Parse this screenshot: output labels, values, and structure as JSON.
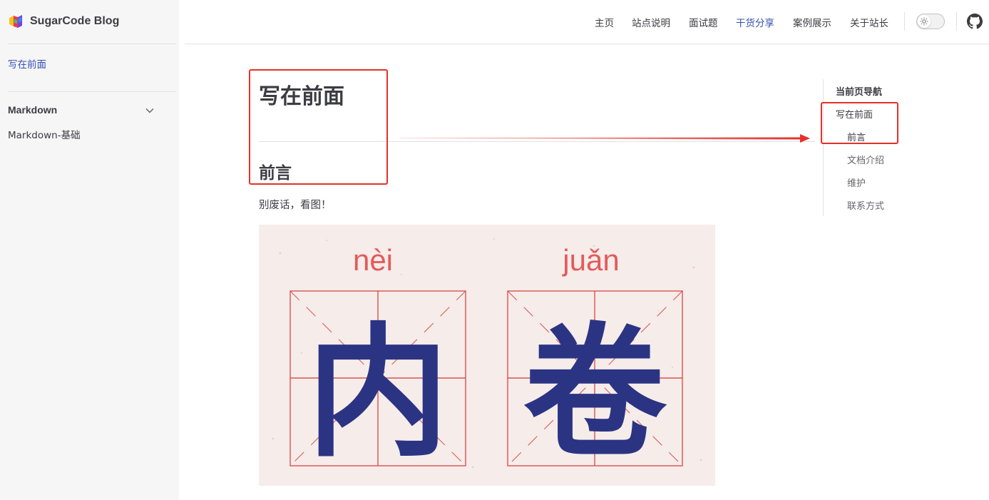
{
  "brand": {
    "name": "SugarCode Blog",
    "logo_icon": "color-cube-logo"
  },
  "sidebar": {
    "top_link": "写在前面",
    "group": {
      "title": "Markdown",
      "items": [
        "Markdown-基础"
      ]
    }
  },
  "nav": {
    "items": [
      "主页",
      "站点说明",
      "面试题",
      "干货分享",
      "案例展示",
      "关于站长"
    ],
    "active": "干货分享",
    "theme_toggle_icon": "sun-icon",
    "github_icon": "github-icon"
  },
  "article": {
    "title": "写在前面",
    "section": "前言",
    "paragraph": "别废话，看图！",
    "image": {
      "pinyin_left": "nèi",
      "pinyin_right": "juǎn",
      "char_left": "内",
      "char_right": "卷"
    }
  },
  "outline": {
    "title": "当前页导航",
    "items": [
      "写在前面",
      "前言",
      "文档介绍",
      "维护",
      "联系方式"
    ]
  },
  "colors": {
    "accent": "#3451b2",
    "annotation": "#e5302a",
    "hero_char": "#2b3483",
    "hero_grid": "#d9534f"
  }
}
